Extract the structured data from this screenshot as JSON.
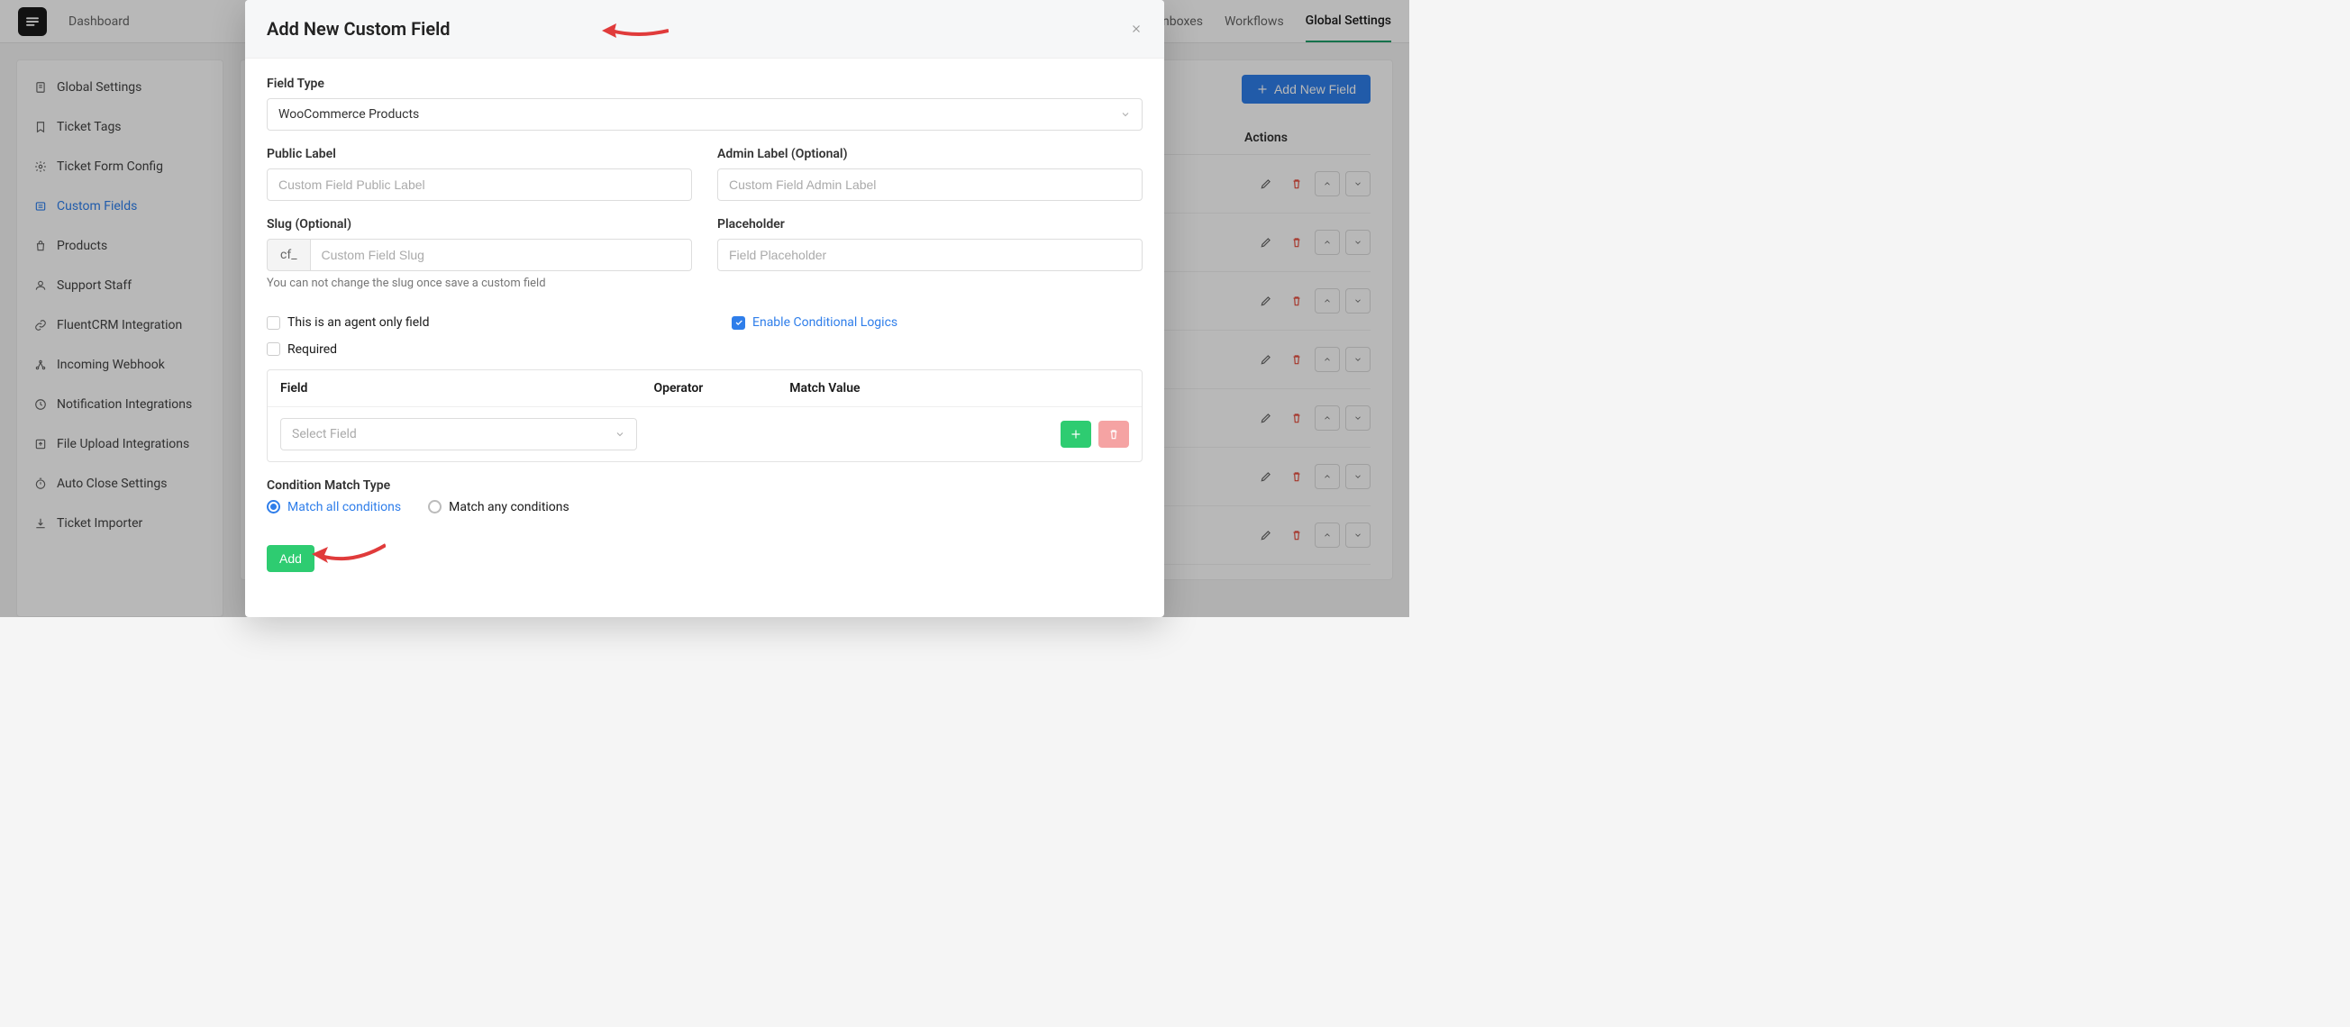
{
  "topnav": {
    "dashboard": "Dashboard",
    "business_inboxes": "Business Inboxes",
    "workflows": "Workflows",
    "global_settings": "Global Settings"
  },
  "sidebar": {
    "items": [
      {
        "label": "Global Settings"
      },
      {
        "label": "Ticket Tags"
      },
      {
        "label": "Ticket Form Config"
      },
      {
        "label": "Custom Fields"
      },
      {
        "label": "Products"
      },
      {
        "label": "Support Staff"
      },
      {
        "label": "FluentCRM Integration"
      },
      {
        "label": "Incoming Webhook"
      },
      {
        "label": "Notification Integrations"
      },
      {
        "label": "File Upload Integrations"
      },
      {
        "label": "Auto Close Settings"
      },
      {
        "label": "Ticket Importer"
      }
    ]
  },
  "content": {
    "add_button": "Add New Field",
    "actions_header": "Actions"
  },
  "modal": {
    "title": "Add New Custom Field",
    "field_type_label": "Field Type",
    "field_type_value": "WooCommerce Products",
    "public_label": "Public Label",
    "public_placeholder": "Custom Field Public Label",
    "admin_label": "Admin Label (Optional)",
    "admin_placeholder": "Custom Field Admin Label",
    "slug_label": "Slug (Optional)",
    "slug_prefix": "cf_",
    "slug_placeholder": "Custom Field Slug",
    "slug_help": "You can not change the slug once save a custom field",
    "placeholder_label": "Placeholder",
    "placeholder_placeholder": "Field Placeholder",
    "agent_only": "This is an agent only field",
    "enable_cond": "Enable Conditional Logics",
    "required": "Required",
    "cond": {
      "field": "Field",
      "operator": "Operator",
      "match_value": "Match Value",
      "select_field": "Select Field"
    },
    "match_type_label": "Condition Match Type",
    "match_all": "Match all conditions",
    "match_any": "Match any conditions",
    "add_button": "Add"
  }
}
